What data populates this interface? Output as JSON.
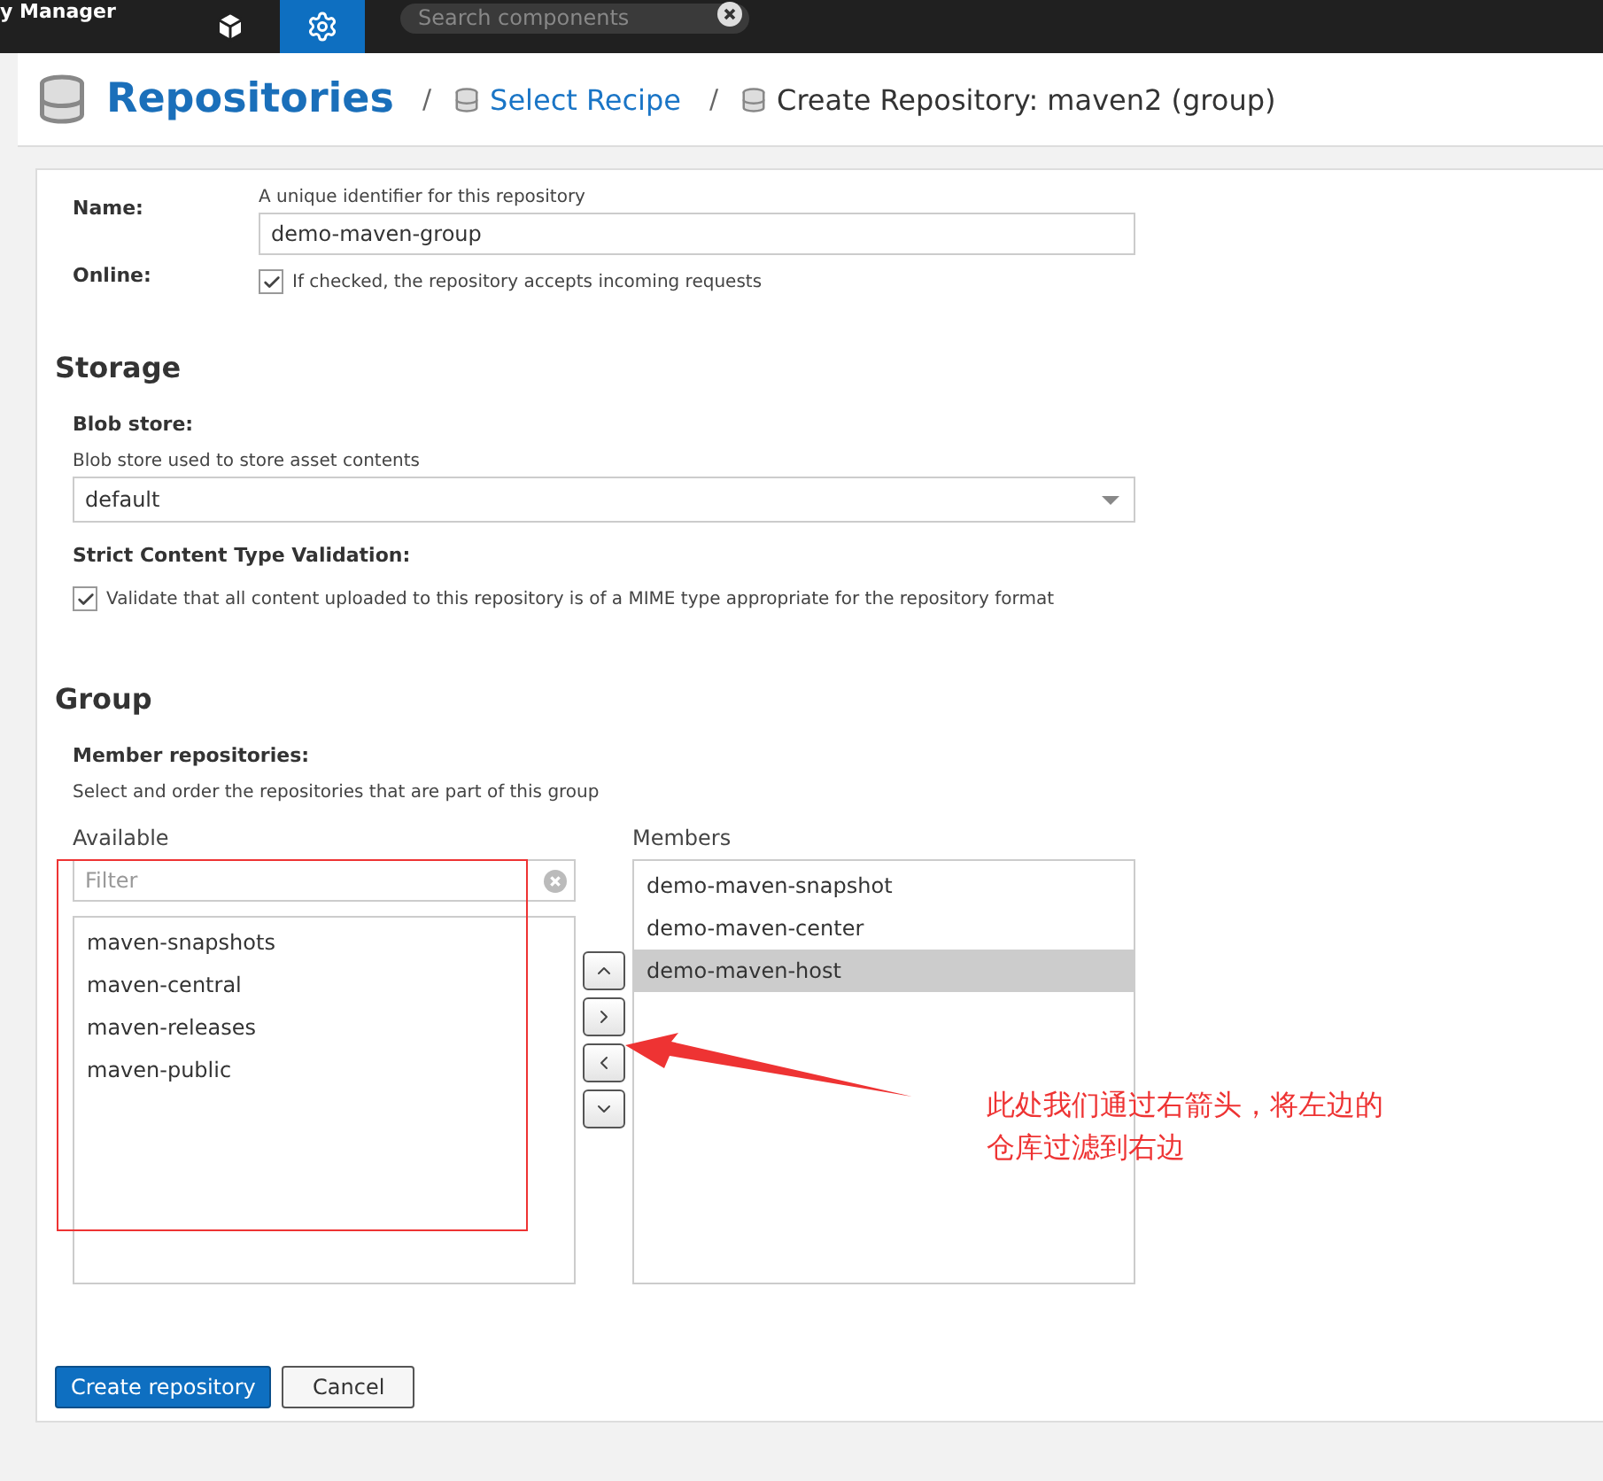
{
  "app_title": "y Manager",
  "toolbar": {
    "tabs": [
      {
        "kind": "browse",
        "selected": false
      },
      {
        "kind": "admin",
        "selected": true
      }
    ],
    "search": {
      "placeholder": "Search components"
    }
  },
  "breadcrumb": {
    "title": "Repositories",
    "items": [
      {
        "separator": "/",
        "label": "Select Recipe",
        "link": true
      },
      {
        "separator": "/",
        "label": "Create Repository: maven2 (group)",
        "link": false
      }
    ]
  },
  "form": {
    "name": {
      "label": "Name:",
      "hint": "A unique identifier for this repository",
      "value": "demo-maven-group"
    },
    "online": {
      "label": "Online:",
      "checked": true,
      "text": "If checked, the repository accepts incoming requests"
    }
  },
  "storage": {
    "heading": "Storage",
    "blob_store": {
      "label": "Blob store:",
      "hint": "Blob store used to store asset contents",
      "value": "default"
    },
    "strict": {
      "label": "Strict Content Type Validation:",
      "checked": true,
      "text": "Validate that all content uploaded to this repository is of a MIME type appropriate for the repository format"
    }
  },
  "group": {
    "heading": "Group",
    "label": "Member repositories:",
    "hint": "Select and order the repositories that are part of this group",
    "available": {
      "label": "Available",
      "filter_placeholder": "Filter",
      "items": [
        {
          "label": "maven-snapshots",
          "selected": false
        },
        {
          "label": "maven-central",
          "selected": false
        },
        {
          "label": "maven-releases",
          "selected": false
        },
        {
          "label": "maven-public",
          "selected": false
        }
      ]
    },
    "move_buttons": [
      {
        "kind": "up"
      },
      {
        "kind": "right"
      },
      {
        "kind": "left"
      },
      {
        "kind": "down"
      }
    ],
    "members": {
      "label": "Members",
      "items": [
        {
          "label": "demo-maven-snapshot",
          "selected": false
        },
        {
          "label": "demo-maven-center",
          "selected": false
        },
        {
          "label": "demo-maven-host",
          "selected": true
        }
      ]
    }
  },
  "buttons": [
    {
      "label": "Create repository",
      "kind": "primary"
    },
    {
      "label": "Cancel",
      "kind": "secondary"
    }
  ],
  "annotation": {
    "text": "此处我们通过右箭头，将左边的仓库过滤到右边"
  }
}
